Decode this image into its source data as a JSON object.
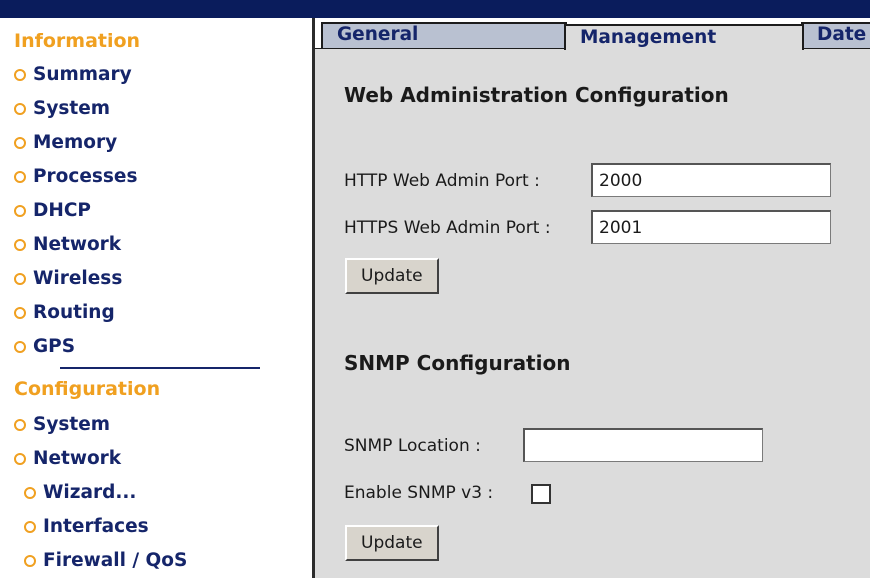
{
  "sidebar": {
    "information_title": "Information",
    "information_items": [
      {
        "label": "Summary"
      },
      {
        "label": "System"
      },
      {
        "label": "Memory"
      },
      {
        "label": "Processes"
      },
      {
        "label": "DHCP"
      },
      {
        "label": "Network"
      },
      {
        "label": "Wireless"
      },
      {
        "label": "Routing"
      },
      {
        "label": "GPS"
      }
    ],
    "configuration_title": "Configuration",
    "configuration_items": [
      {
        "label": "System"
      },
      {
        "label": "Network"
      }
    ],
    "network_subitems": [
      {
        "label": "Wizard..."
      },
      {
        "label": "Interfaces"
      },
      {
        "label": "Firewall / QoS"
      }
    ],
    "bullet_icon": "circle-bullet-icon"
  },
  "tabs": [
    {
      "label": "General"
    },
    {
      "label": "Management",
      "active": true
    },
    {
      "label": "Date"
    }
  ],
  "web_admin": {
    "heading": "Web Administration Configuration",
    "http_label": "HTTP Web Admin Port :",
    "http_value": "2000",
    "https_label": "HTTPS Web Admin Port :",
    "https_value": "2001",
    "update_label": "Update"
  },
  "snmp": {
    "heading": "SNMP Configuration",
    "location_label": "SNMP Location :",
    "location_value": "",
    "v3_label": "Enable SNMP v3 :",
    "v3_checked": false,
    "update_label": "Update"
  },
  "colors": {
    "accent": "#f0a020",
    "nav_text": "#15256a",
    "panel_bg": "#dcdcdc",
    "tab_bg": "#b9c1d1"
  }
}
